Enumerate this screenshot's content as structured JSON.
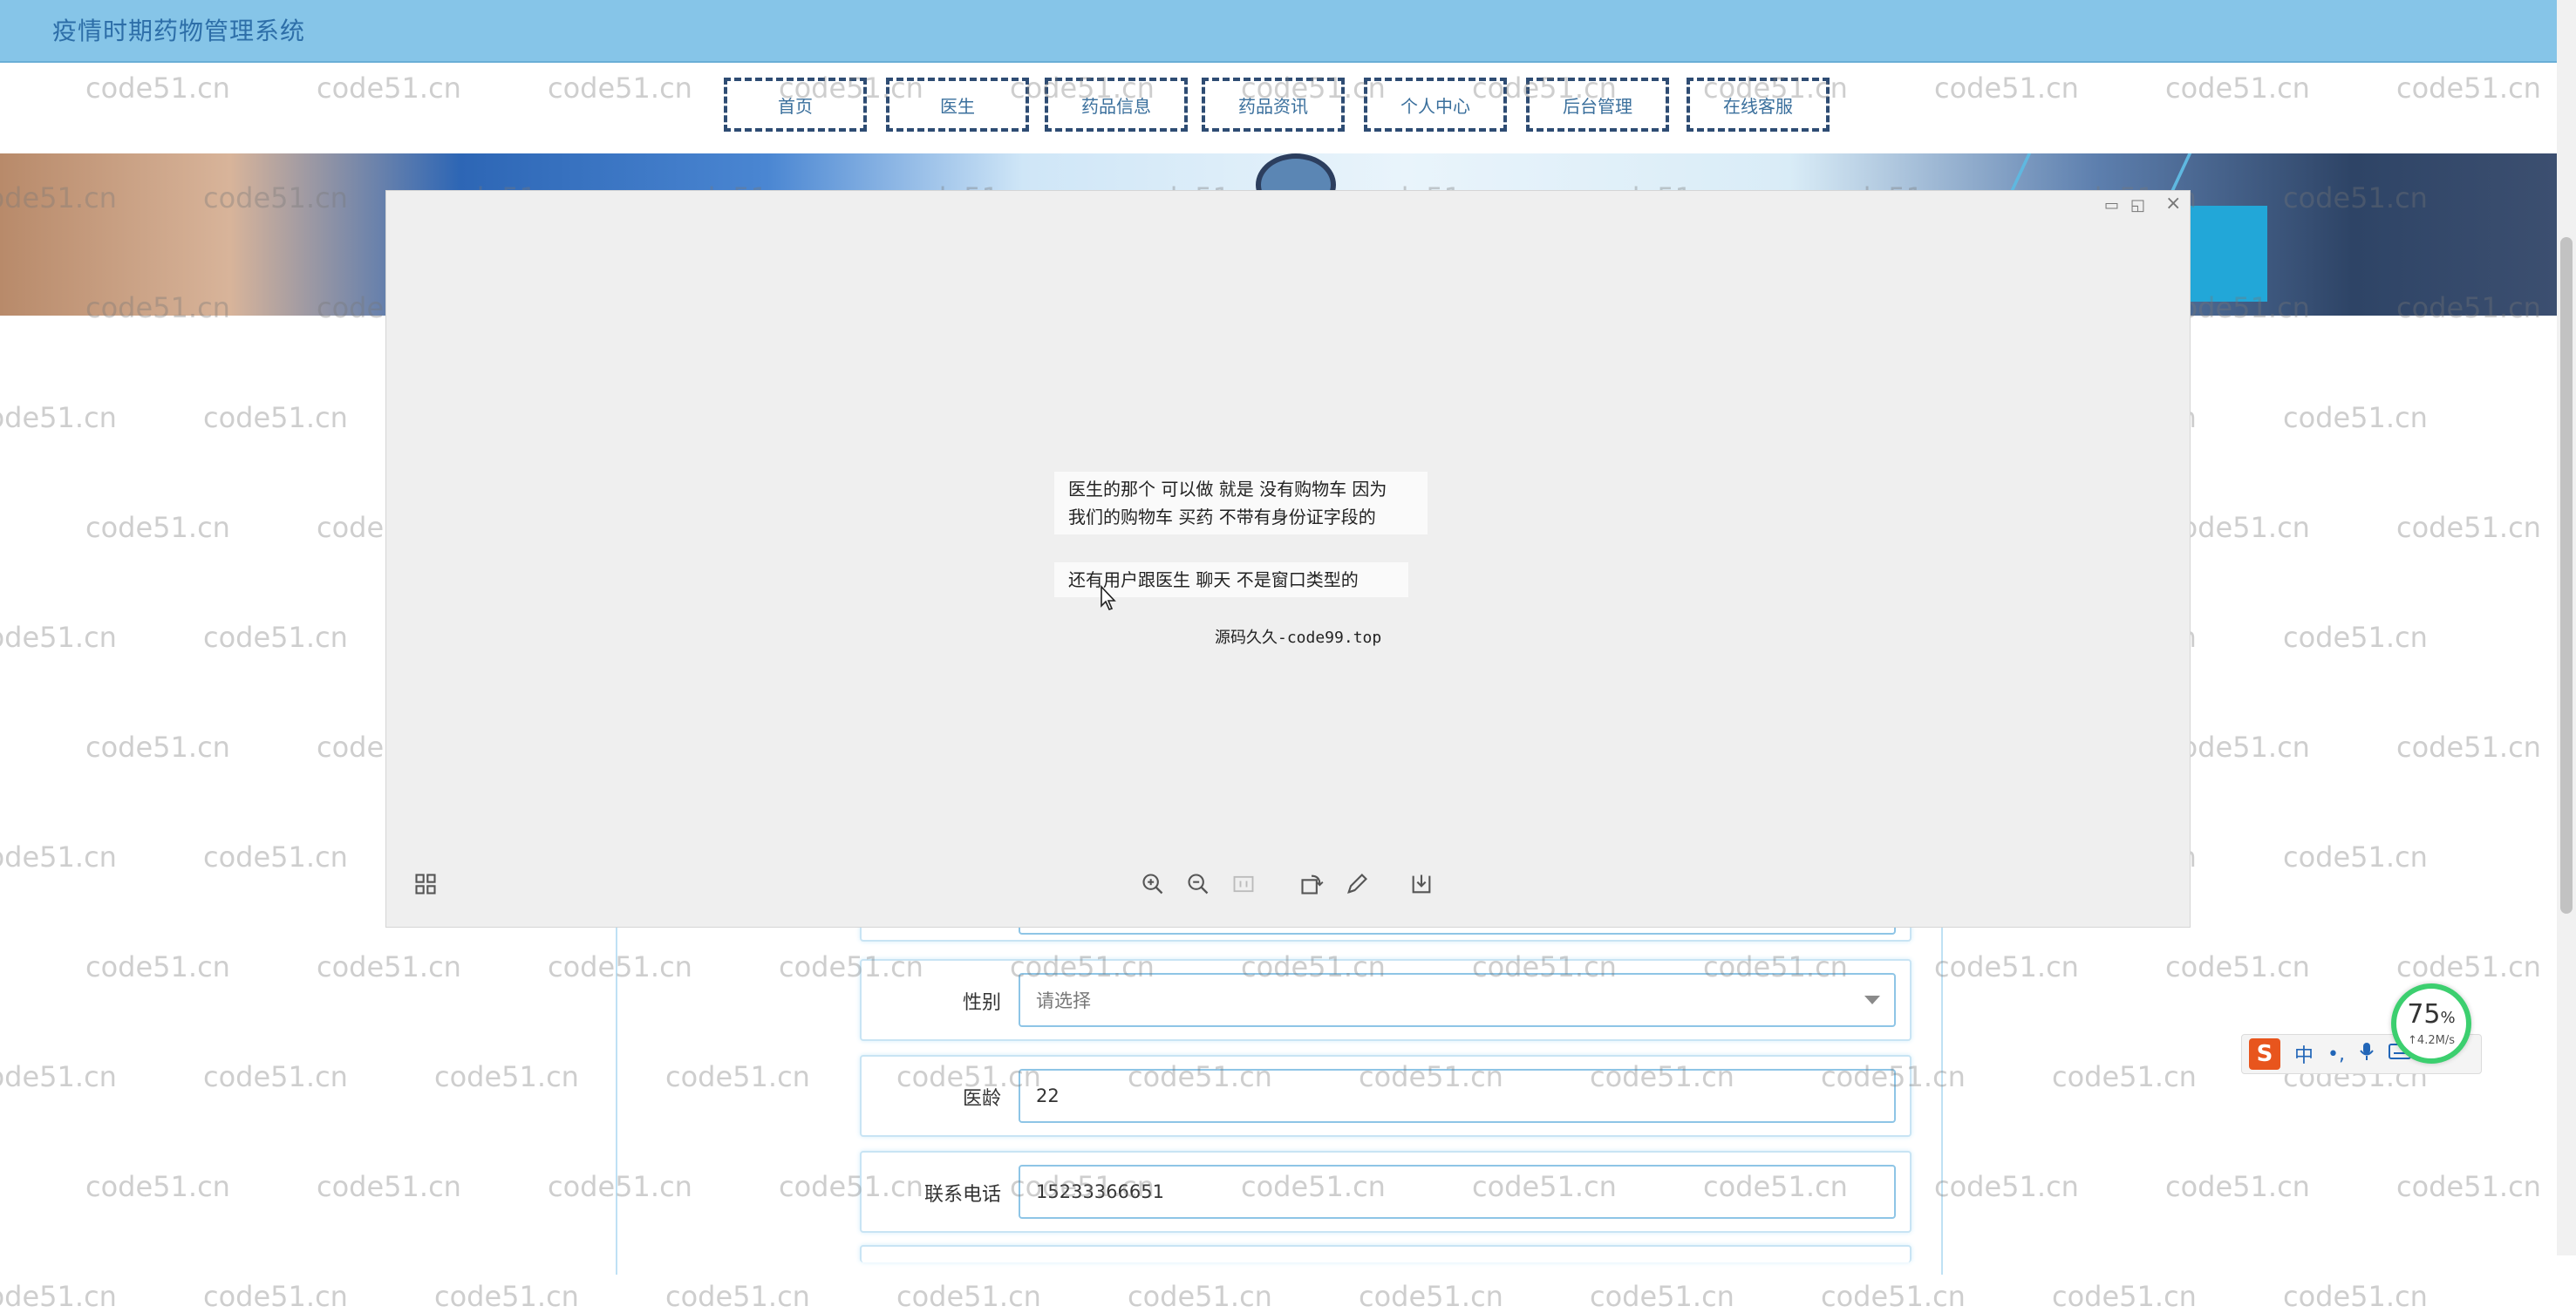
{
  "app": {
    "title": "疫情时期药物管理系统"
  },
  "nav": {
    "items": [
      {
        "label": "首页"
      },
      {
        "label": "医生"
      },
      {
        "label": "药品信息"
      },
      {
        "label": "药品资讯"
      },
      {
        "label": "个人中心"
      },
      {
        "label": "后台管理"
      },
      {
        "label": "在线客服"
      }
    ]
  },
  "watermark": {
    "text": "code51.cn"
  },
  "viewer": {
    "note_lines": [
      "医生的那个 可以做 就是 没有购物车 因为",
      "我们的购物车 买药 不带有身份证字段的",
      "还有用户跟医生 聊天 不是窗口类型的"
    ],
    "signature": "源码久久-code99.top",
    "close_symbol": "×",
    "toolbar": [
      "zoom-in-icon",
      "zoom-out-icon",
      "actual-size-icon",
      "rotate-icon",
      "edit-icon",
      "download-icon"
    ]
  },
  "form": {
    "gender": {
      "label": "性别",
      "placeholder": "请选择"
    },
    "years": {
      "label": "医龄",
      "value": "22"
    },
    "phone": {
      "label": "联系电话",
      "value": "15233366651"
    }
  },
  "widgets": {
    "speed_percent": "75",
    "speed_unit": "%",
    "speed_rate": "↑4.2M/s",
    "ime_logo": "S",
    "ime_lang": "中",
    "ime_punct": "•,"
  },
  "colors": {
    "header": "#86c5e8",
    "nav_border": "#2e4c73",
    "accent": "#3a6f9c"
  }
}
